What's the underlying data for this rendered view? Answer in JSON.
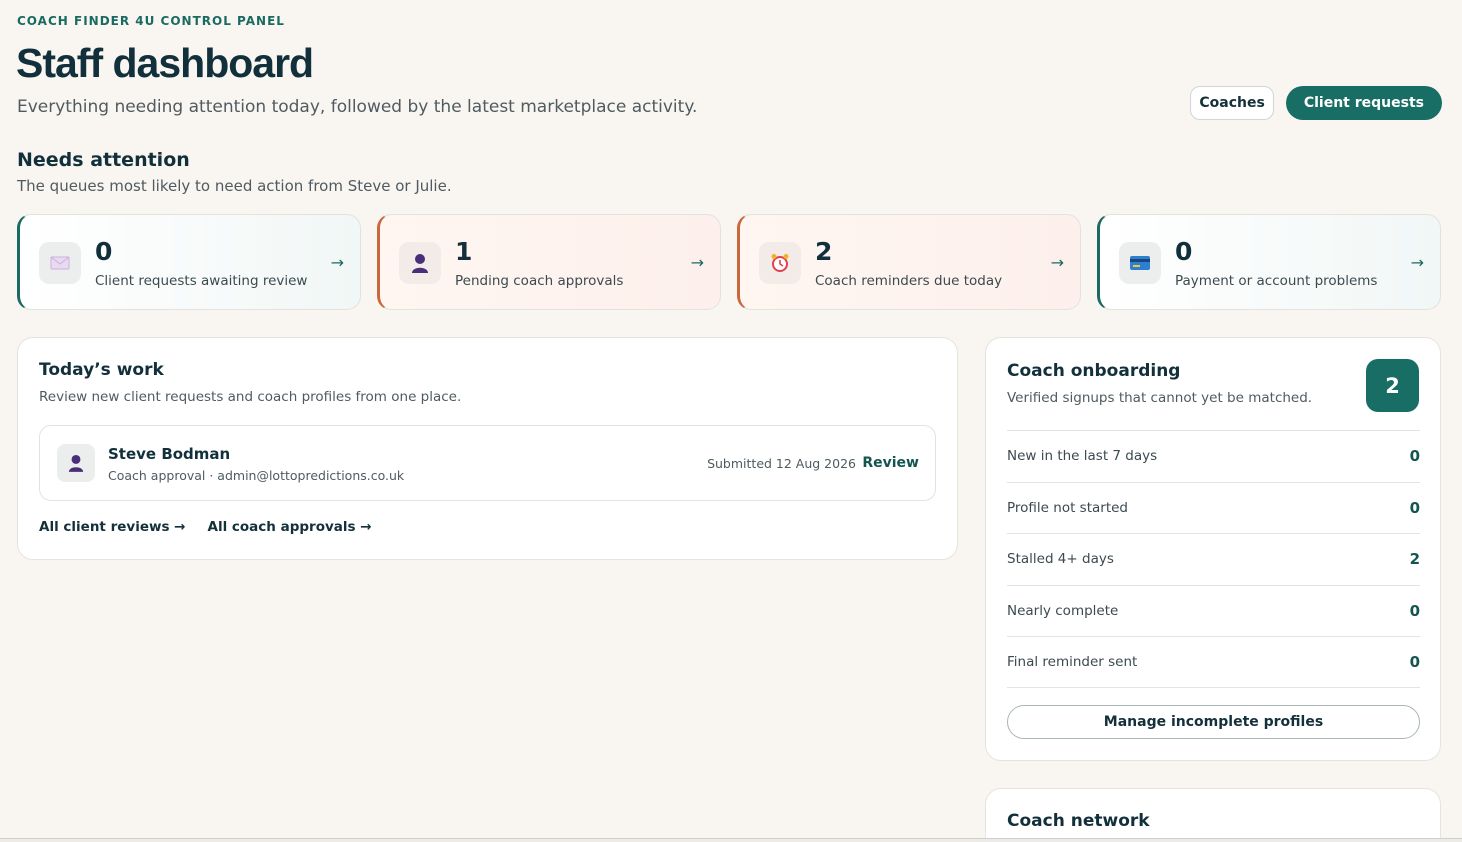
{
  "header": {
    "eyebrow": "COACH FINDER 4U CONTROL PANEL",
    "title": "Staff dashboard",
    "subtitle": "Everything needing attention today, followed by the latest marketplace activity.",
    "coaches_label": "Coaches",
    "client_requests_label": "Client requests"
  },
  "attention": {
    "title": "Needs attention",
    "subtitle": "The queues most likely to need action from Steve or Julie.",
    "tiles": [
      {
        "count": "0",
        "label": "Client requests awaiting review",
        "icon": "envelope-icon",
        "arrow": "→"
      },
      {
        "count": "1",
        "label": "Pending coach approvals",
        "icon": "person-icon",
        "arrow": "→"
      },
      {
        "count": "2",
        "label": "Coach reminders due today",
        "icon": "alarm-clock-icon",
        "arrow": "→"
      },
      {
        "count": "0",
        "label": "Payment or account problems",
        "icon": "credit-card-icon",
        "arrow": "→"
      }
    ]
  },
  "work": {
    "title": "Today’s work",
    "subtitle": "Review new client requests and coach profiles from one place.",
    "item": {
      "name": "Steve Bodman",
      "meta": "Coach approval · admin@lottopredictions.co.uk",
      "submitted": "Submitted 12 Aug 2026",
      "action": "Review"
    },
    "links": [
      "All client reviews →",
      "All coach approvals →"
    ]
  },
  "onboarding": {
    "title": "Coach onboarding",
    "subtitle": "Verified signups that cannot yet be matched.",
    "total": "2",
    "stats": [
      {
        "label": "New in the last 7 days",
        "value": "0"
      },
      {
        "label": "Profile not started",
        "value": "0"
      },
      {
        "label": "Stalled 4+ days",
        "value": "2"
      },
      {
        "label": "Nearly complete",
        "value": "0"
      },
      {
        "label": "Final reminder sent",
        "value": "0"
      }
    ],
    "manage_label": "Manage incomplete profiles"
  },
  "network": {
    "title": "Coach network"
  },
  "colors": {
    "accent": "#186d64",
    "warm": "#c9683f",
    "background": "#f9f6f1"
  }
}
